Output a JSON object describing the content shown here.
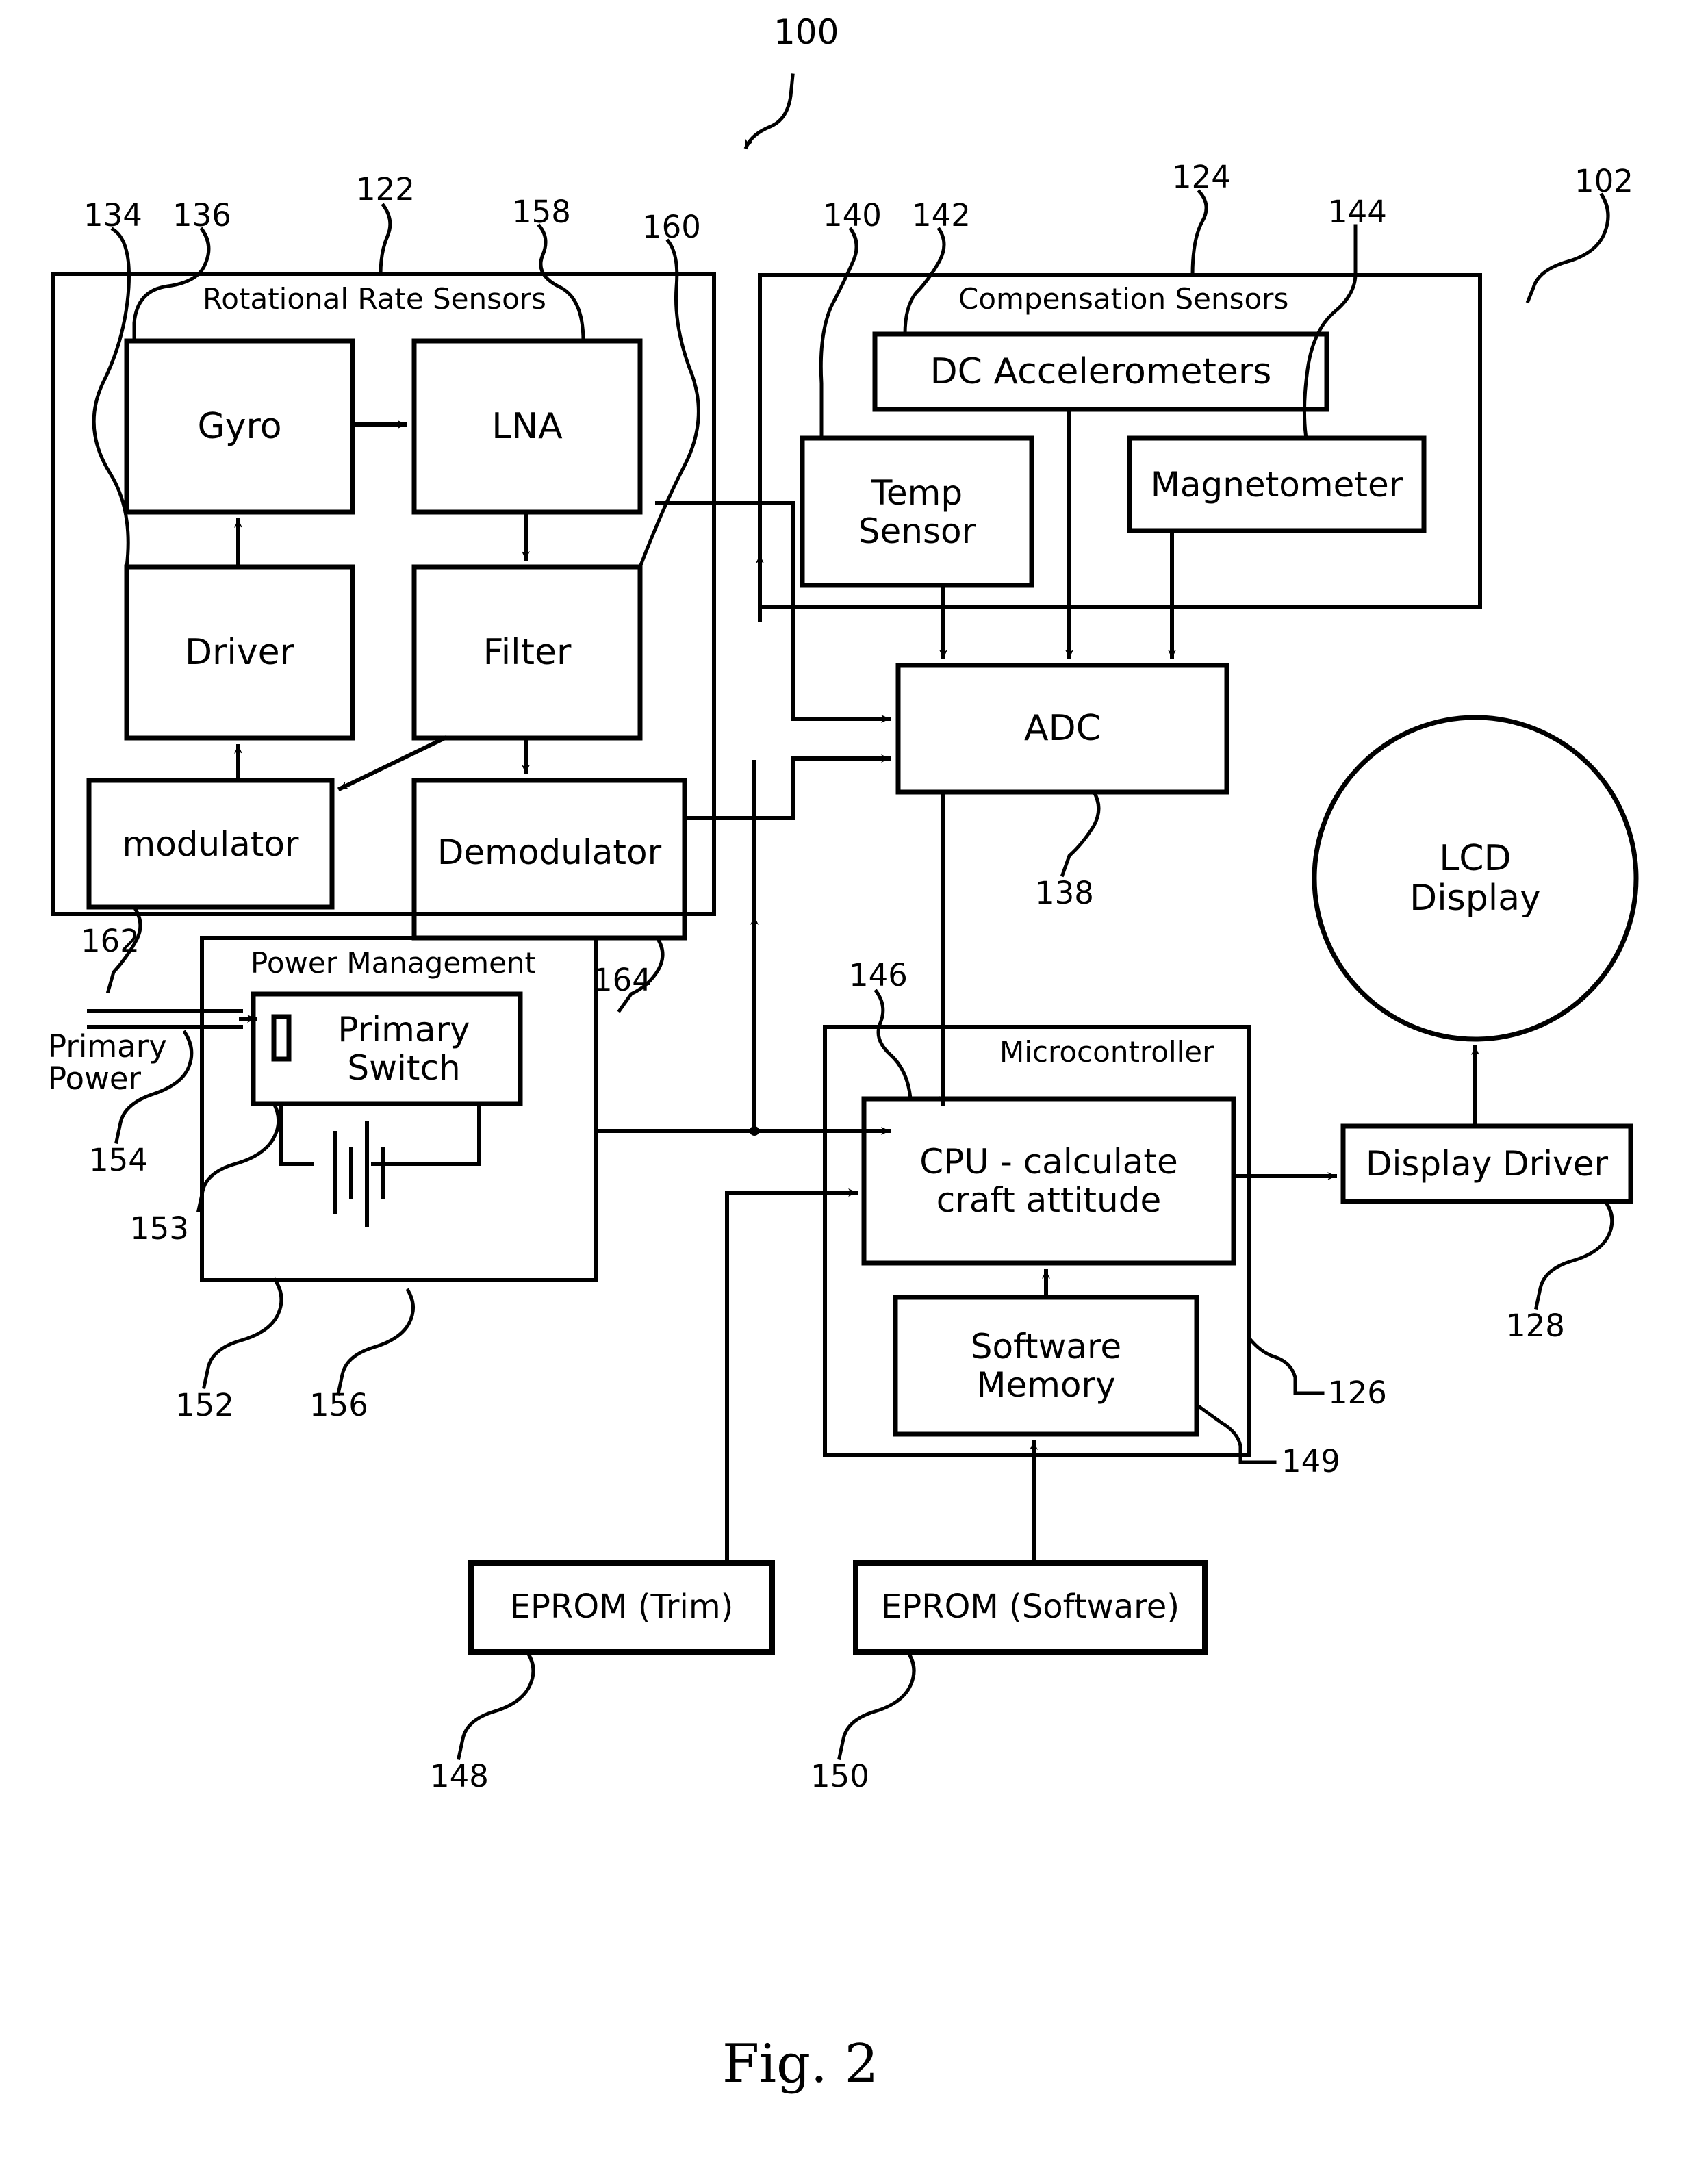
{
  "figure": {
    "caption": "Fig. 2",
    "system_ref": "100"
  },
  "groups": [
    {
      "id": "rotational-rate-sensors",
      "title": "Rotational Rate Sensors",
      "ref": "122"
    },
    {
      "id": "compensation-sensors",
      "title": "Compensation Sensors",
      "ref": "124"
    },
    {
      "id": "power-management",
      "title": "Power Management",
      "ref": "152"
    },
    {
      "id": "microcontroller",
      "title": "Microcontroller",
      "ref": "126"
    }
  ],
  "blocks": [
    {
      "id": "gyro",
      "label": "Gyro",
      "ref": "136"
    },
    {
      "id": "lna",
      "label": "LNA",
      "ref": "158"
    },
    {
      "id": "driver",
      "label": "Driver",
      "ref": "134"
    },
    {
      "id": "filter",
      "label": "Filter",
      "ref": "160"
    },
    {
      "id": "modulator",
      "label": "modulator",
      "ref": "162"
    },
    {
      "id": "demodulator",
      "label": "Demodulator",
      "ref": "164"
    },
    {
      "id": "dc-accelerometers",
      "label": "DC Accelerometers",
      "ref": "142"
    },
    {
      "id": "temp-sensor",
      "label": "Temp\nSensor",
      "ref": "140"
    },
    {
      "id": "magnetometer",
      "label": "Magnetometer",
      "ref": "144"
    },
    {
      "id": "adc",
      "label": "ADC",
      "ref": "138"
    },
    {
      "id": "primary-switch",
      "label": "Primary\nSwitch",
      "ref": "153"
    },
    {
      "id": "battery",
      "label": "",
      "ref": "156"
    },
    {
      "id": "cpu",
      "label": "CPU - calculate\ncraft attitude",
      "ref": "146"
    },
    {
      "id": "software-memory",
      "label": "Software\nMemory",
      "ref": "149"
    },
    {
      "id": "display-driver",
      "label": "Display Driver",
      "ref": "128"
    },
    {
      "id": "lcd-display",
      "label": "LCD\nDisplay",
      "ref": "102"
    },
    {
      "id": "eprom-trim",
      "label": "EPROM (Trim)",
      "ref": "148"
    },
    {
      "id": "eprom-software",
      "label": "EPROM (Software)",
      "ref": "150"
    }
  ],
  "annotations": {
    "primary_power": "Primary\nPower",
    "primary_power_ref": "154"
  },
  "reference_numerals": [
    {
      "id": "ref-100",
      "value": "100"
    },
    {
      "id": "ref-134",
      "value": "134"
    },
    {
      "id": "ref-136",
      "value": "136"
    },
    {
      "id": "ref-122",
      "value": "122"
    },
    {
      "id": "ref-158",
      "value": "158"
    },
    {
      "id": "ref-160",
      "value": "160"
    },
    {
      "id": "ref-140",
      "value": "140"
    },
    {
      "id": "ref-142",
      "value": "142"
    },
    {
      "id": "ref-124",
      "value": "124"
    },
    {
      "id": "ref-144",
      "value": "144"
    },
    {
      "id": "ref-102",
      "value": "102"
    },
    {
      "id": "ref-138",
      "value": "138"
    },
    {
      "id": "ref-162",
      "value": "162"
    },
    {
      "id": "ref-164",
      "value": "164"
    },
    {
      "id": "ref-146",
      "value": "146"
    },
    {
      "id": "ref-154",
      "value": "154"
    },
    {
      "id": "ref-153",
      "value": "153"
    },
    {
      "id": "ref-152",
      "value": "152"
    },
    {
      "id": "ref-156",
      "value": "156"
    },
    {
      "id": "ref-126",
      "value": "126"
    },
    {
      "id": "ref-149",
      "value": "149"
    },
    {
      "id": "ref-128",
      "value": "128"
    },
    {
      "id": "ref-148",
      "value": "148"
    },
    {
      "id": "ref-150",
      "value": "150"
    }
  ],
  "colors": {
    "ink": "#000000",
    "paper": "#ffffff"
  }
}
